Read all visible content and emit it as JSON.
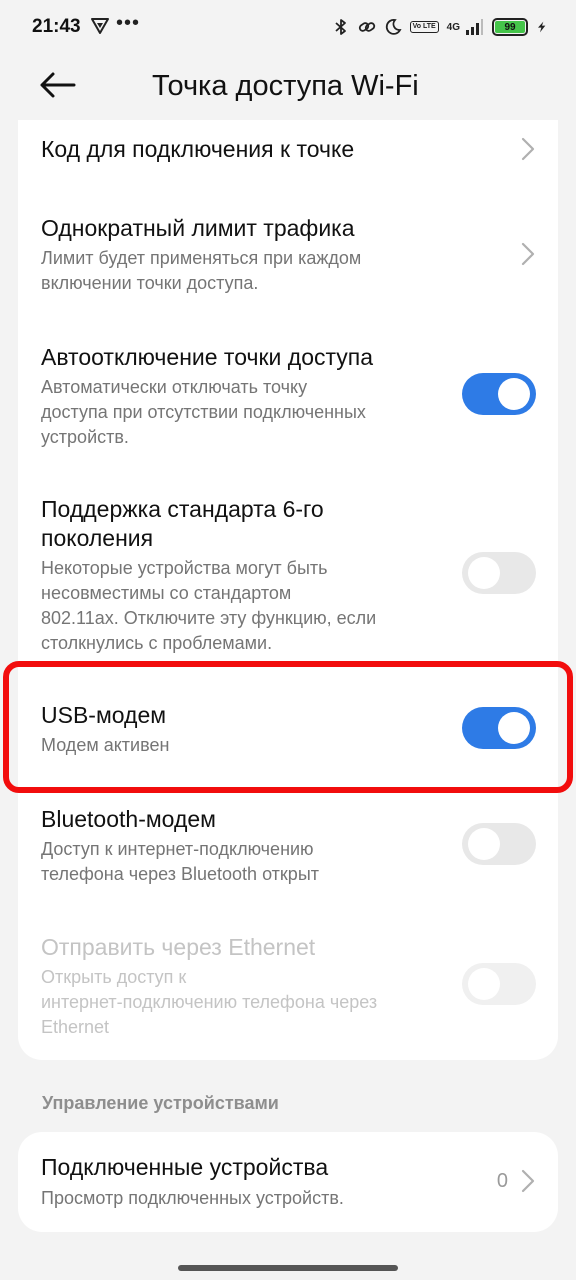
{
  "status_bar": {
    "time": "21:43",
    "dots": "•••",
    "volte": "Vo LTE",
    "network": "4G",
    "battery": "99"
  },
  "header": {
    "title": "Точка доступа Wi-Fi"
  },
  "items": [
    {
      "title": "Код для подключения к точке",
      "control": "chevron"
    },
    {
      "title": "Однократный лимит трафика",
      "subtitle_line1": "Лимит будет применяться при каждом",
      "subtitle_line2": "включении точки доступа.",
      "control": "chevron"
    },
    {
      "title": "Автоотключение точки доступа",
      "subtitle_line1": "Автоматически отключать точку",
      "subtitle_line2": "доступа при отсутствии подключенных",
      "subtitle_line3": "устройств.",
      "control": "toggle",
      "state": "on"
    },
    {
      "title_line1": "Поддержка стандарта 6-го",
      "title_line2": "поколения",
      "subtitle_line1": "Некоторые устройства могут быть",
      "subtitle_line2": "несовместимы со стандартом",
      "subtitle_line3": "802.11ax. Отключите эту функцию, если",
      "subtitle_line4": "столкнулись с проблемами.",
      "control": "toggle",
      "state": "off"
    },
    {
      "title": "USB-модем",
      "subtitle_line1": "Модем активен",
      "control": "toggle",
      "state": "on"
    },
    {
      "title": "Bluetooth-модем",
      "subtitle_line1": "Доступ к интернет-подключению",
      "subtitle_line2": "телефона через Bluetooth открыт",
      "control": "toggle",
      "state": "off"
    },
    {
      "title": "Отправить через Ethernet",
      "subtitle_line1": "Открыть доступ к",
      "subtitle_line2": "интернет-подключению телефона через",
      "subtitle_line3": "Ethernet",
      "control": "toggle",
      "state": "disabled"
    }
  ],
  "section": {
    "title": "Управление устройствами"
  },
  "devices": {
    "title": "Подключенные устройства",
    "subtitle": "Просмотр подключенных устройств.",
    "count": "0"
  },
  "colors": {
    "accent": "#2e7be6",
    "highlight": "#f20d0d",
    "battery": "#45c54a"
  }
}
